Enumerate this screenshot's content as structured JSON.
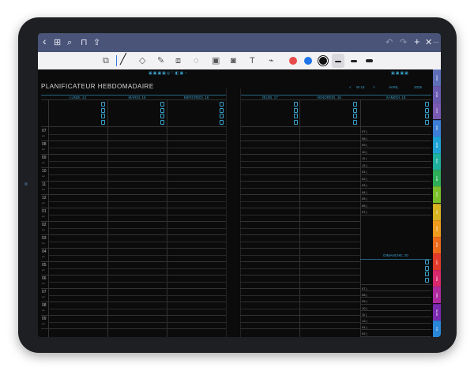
{
  "navbar": {
    "icons": [
      "back-icon",
      "grid-icon",
      "search-icon",
      "bookmark-icon",
      "share-icon",
      "undo-icon",
      "redo-icon",
      "add-icon",
      "close-icon",
      "more-icon"
    ],
    "glyphs": {
      "back": "‹",
      "grid": "⊞",
      "search": "⌕",
      "bookmark": "⊓",
      "share": "⇪",
      "undo": "↶",
      "redo": "↷",
      "add": "+",
      "close": "✕",
      "more": "···"
    }
  },
  "toolbar": {
    "tools": [
      "page-icon",
      "pen-icon",
      "eraser-icon",
      "highlighter-icon",
      "shapes-icon",
      "lasso-icon",
      "image-icon",
      "camera-icon",
      "text-icon",
      "laser-icon"
    ],
    "colors": [
      "#e94b4b",
      "#1e73e8",
      "#111111"
    ]
  },
  "planner": {
    "title": "PLANIFICATEUR HEBDOMADAIRE",
    "week_prev": "<",
    "week": "W 16",
    "week_next": ">",
    "month": "AVRIL",
    "year": "2025",
    "days_left": [
      "LUNDI, 14",
      "MARDI, 15",
      "MERCREDI, 16"
    ],
    "days_right": [
      "JEUDI, 17",
      "VENDREDI, 18",
      "SAMEDI, 19"
    ],
    "sunday": "DIMANCHE, 20",
    "hours": [
      "07",
      "08",
      "09",
      "10",
      "11",
      "12",
      "01",
      "02",
      "03",
      "04",
      "05",
      "06",
      "07",
      "08",
      "09"
    ],
    "ampm": [
      "am",
      "am",
      "am",
      "am",
      "am",
      "pm",
      "pm",
      "pm",
      "pm",
      "pm",
      "pm",
      "pm",
      "pm",
      "pm",
      "pm"
    ],
    "sat_hours": [
      "07",
      "08",
      "09",
      "10",
      "11",
      "12",
      "01",
      "02",
      "03",
      "04",
      "05",
      "06",
      "07"
    ],
    "sun_hours": [
      "07",
      "08",
      "09",
      "10",
      "11",
      "12",
      "01",
      "02",
      "03",
      "04",
      "05",
      "06"
    ]
  },
  "tabs": [
    {
      "label": "2024",
      "color": "#5e6fb8"
    },
    {
      "label": "2025",
      "color": "#6b5bb0"
    },
    {
      "label": "JAN",
      "color": "#7a5ab3"
    },
    {
      "label": "FEB",
      "color": "#3d7fd6"
    },
    {
      "label": "MAR",
      "color": "#1fa3d6"
    },
    {
      "label": "APR",
      "color": "#1fb1a0"
    },
    {
      "label": "MAY",
      "color": "#2fae5a"
    },
    {
      "label": "JUN",
      "color": "#7cbf2a"
    },
    {
      "label": "JUL",
      "color": "#d8b420"
    },
    {
      "label": "AUG",
      "color": "#ee9a1c"
    },
    {
      "label": "SEP",
      "color": "#ee6b1c"
    },
    {
      "label": "OCT",
      "color": "#e23a2a"
    },
    {
      "label": "NOV",
      "color": "#d9286b"
    },
    {
      "label": "DEC",
      "color": "#b02aa0"
    },
    {
      "label": "NOTE",
      "color": "#7a2ab0"
    },
    {
      "label": "ICE",
      "color": "#2a86d6"
    }
  ]
}
